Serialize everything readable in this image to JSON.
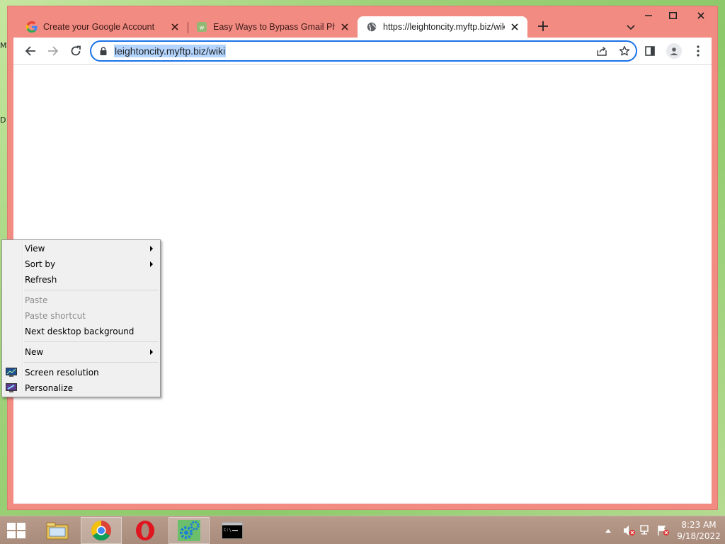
{
  "desktop": {
    "edge_glyphs": [
      "M",
      "D"
    ]
  },
  "browser": {
    "tabs": [
      {
        "title": "Create your Google Account",
        "icon": "google-g-icon",
        "active": false
      },
      {
        "title": "Easy Ways to Bypass Gmail Phone",
        "icon": "wikihow-icon",
        "active": false
      },
      {
        "title": "https://leightoncity.myftp.biz/wiki",
        "icon": "globe-icon",
        "active": true
      }
    ],
    "url": "leightoncity.myftp.biz/wiki"
  },
  "context_menu": {
    "items": [
      {
        "label": "View",
        "submenu": true,
        "disabled": false
      },
      {
        "label": "Sort by",
        "submenu": true,
        "disabled": false
      },
      {
        "label": "Refresh",
        "submenu": false,
        "disabled": false
      },
      {
        "separator": true
      },
      {
        "label": "Paste",
        "submenu": false,
        "disabled": true
      },
      {
        "label": "Paste shortcut",
        "submenu": false,
        "disabled": true
      },
      {
        "label": "Next desktop background",
        "submenu": false,
        "disabled": false
      },
      {
        "separator": true
      },
      {
        "label": "New",
        "submenu": true,
        "disabled": false
      },
      {
        "separator": true
      },
      {
        "label": "Screen resolution",
        "submenu": false,
        "disabled": false,
        "icon": "monitor-icon"
      },
      {
        "label": "Personalize",
        "submenu": false,
        "disabled": false,
        "icon": "personalize-icon"
      }
    ]
  },
  "taskbar": {
    "apps": [
      "file-explorer-icon",
      "chrome-icon",
      "opera-icon",
      "settings-gears-icon",
      "command-prompt-icon"
    ],
    "clock": {
      "time": "8:23 AM",
      "date": "9/18/2022"
    }
  },
  "colors": {
    "window_frame": "#f28b82",
    "url_highlight": "#b3d4fc",
    "focus_ring": "#1a73e8",
    "taskbar": "#a88b7b"
  }
}
